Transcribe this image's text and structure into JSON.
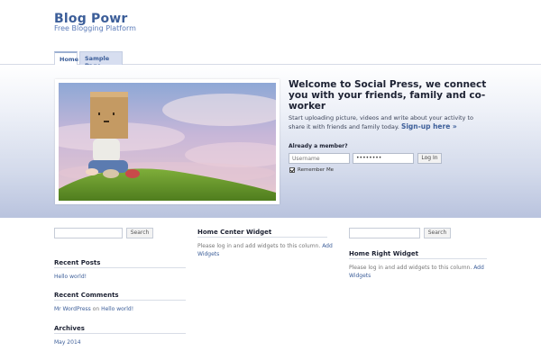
{
  "header": {
    "site_title": "Blog Powr",
    "site_description": "Free Blogging Platform"
  },
  "nav": {
    "tabs": [
      {
        "label": "Home"
      },
      {
        "label": "Sample Page"
      }
    ]
  },
  "hero": {
    "title": "Welcome to Social Press, we connect you with your friends, family and co-worker",
    "text": "Start uploading picture, videos and write about your activity to share it with friends and family today.",
    "signup_label": "Sign-up here »",
    "member_label": "Already a member?",
    "username_placeholder": "Username",
    "password_value": "••••••••",
    "login_label": "Log In",
    "remember_label": "Remember Me"
  },
  "left_column": {
    "search_label": "Search",
    "recent_posts_title": "Recent Posts",
    "recent_posts": [
      "Hello world!"
    ],
    "recent_comments_title": "Recent Comments",
    "comment_author": "Mr WordPress",
    "comment_on": "on",
    "comment_post": "Hello world!",
    "archives_title": "Archives",
    "archives": [
      "May 2014"
    ]
  },
  "center_column": {
    "title": "Home Center Widget",
    "text": "Please log in and add widgets to this column.",
    "link": "Add Widgets"
  },
  "right_column": {
    "search_label": "Search",
    "title": "Home Right Widget",
    "text": "Please log in and add widgets to this column.",
    "link": "Add Widgets"
  },
  "colors": {
    "brand": "#3c5e99",
    "hero_bottom": "#b9c3de"
  }
}
